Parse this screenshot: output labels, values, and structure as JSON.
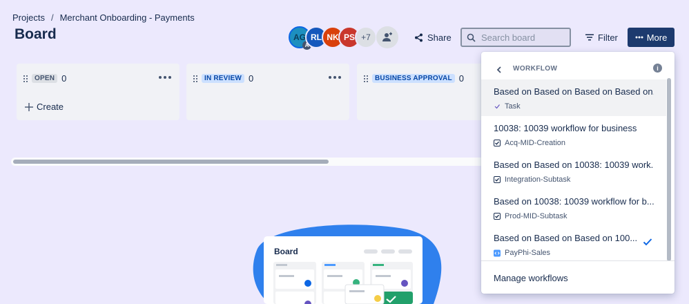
{
  "breadcrumb": {
    "project": "Projects",
    "separator": "/",
    "board_name": "Merchant Onboarding - Payments"
  },
  "title": "Board",
  "avatars": [
    {
      "initials": "AG",
      "badge": "A"
    },
    {
      "initials": "RL"
    },
    {
      "initials": "NK"
    },
    {
      "initials": "PS"
    },
    {
      "initials": "+7"
    }
  ],
  "toolbar": {
    "share_label": "Share",
    "search_placeholder": "Search board",
    "filter_label": "Filter",
    "more_label": "More"
  },
  "columns": [
    {
      "label": "OPEN",
      "count": "0",
      "create_label": "Create"
    },
    {
      "label": "IN REVIEW",
      "count": "0"
    },
    {
      "label": "BUSINESS APPROVAL",
      "count": "0"
    }
  ],
  "illustration": {
    "title": "Board"
  },
  "workflow_menu": {
    "title": "WORKFLOW",
    "items": [
      {
        "name": "Based on Based on Based on Based on...",
        "issue_type": "Task",
        "icon": "task-icon"
      },
      {
        "name": "10038: 10039 workflow for business",
        "issue_type": "Acq-MID-Creation",
        "icon": "checkbox-icon"
      },
      {
        "name": "Based on Based on 10038: 10039 work...",
        "issue_type": "Integration-Subtask",
        "icon": "checkbox-icon"
      },
      {
        "name": "Based on 10038: 10039 workflow for b...",
        "issue_type": "Prod-MID-Subtask",
        "icon": "checkbox-icon"
      },
      {
        "name": "Based on Based on Based on 100...",
        "issue_type": "PayPhi-Sales",
        "icon": "code-icon",
        "selected": true
      }
    ],
    "footer_label": "Manage workflows"
  },
  "colors": {
    "accent": "#0c66e4",
    "primary_button": "#1d3a6e",
    "background": "#ece9fd"
  }
}
